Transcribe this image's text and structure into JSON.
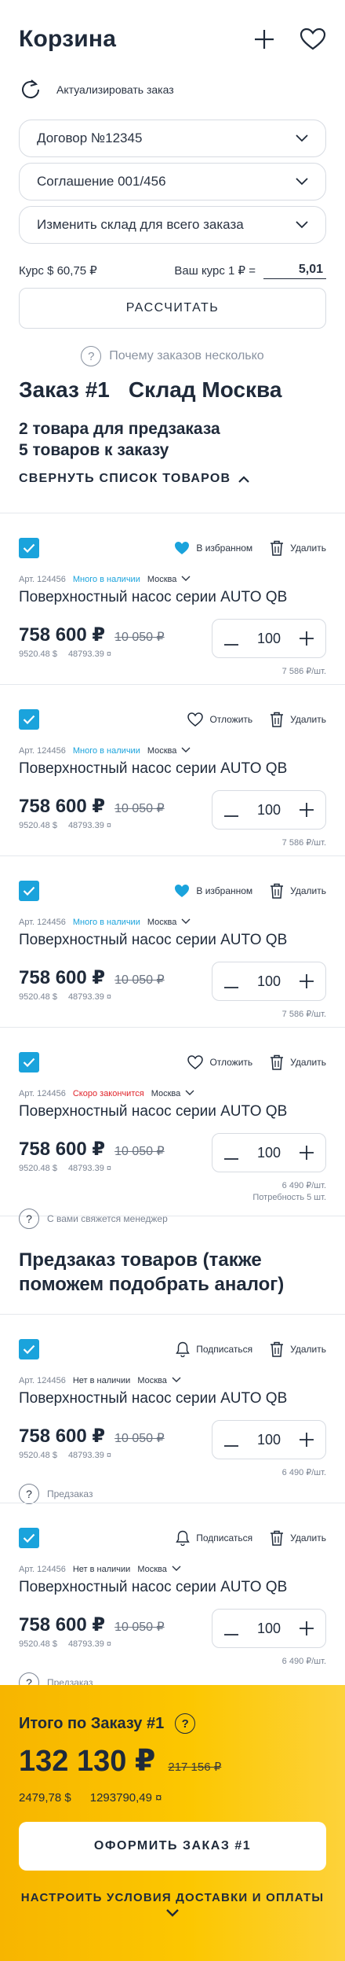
{
  "header": {
    "title": "Корзина"
  },
  "refresh": {
    "label": "Актуализировать заказ"
  },
  "selects": [
    {
      "value": "Договор №12345"
    },
    {
      "value": "Соглашение 001/456"
    },
    {
      "value": "Изменить склад для всего заказа"
    }
  ],
  "rate": {
    "current": "Курс $ 60,75 ₽",
    "custom_label": "Ваш курс 1 ₽ =",
    "custom_value": "5,01"
  },
  "calculate_button": "РАССЧИТАТЬ",
  "why_multiple": "Почему заказов несколько",
  "order": {
    "title": "Заказ #1",
    "warehouse": "Склад Москва",
    "preorder_count": "2 товара для предзаказа",
    "order_count": "5 товаров к заказу",
    "collapse_label": "СВЕРНУТЬ СПИСОК ТОВАРОВ"
  },
  "products": [
    {
      "article": "Арт. 124456",
      "status": "Много в наличии",
      "warehouse": "Москва",
      "name": "Поверхностный насос серии AUTO QB",
      "price": "758 600 ₽",
      "old_price": "10 050 ₽",
      "price_usd": "9520.48 $",
      "price_kzt": "48793.39 ¤",
      "qty": "100",
      "unit_price": "7 586 ₽/шт.",
      "fav_label": "В избранном",
      "favorited": true,
      "delete_label": "Удалить"
    },
    {
      "article": "Арт. 124456",
      "status": "Много в наличии",
      "warehouse": "Москва",
      "name": "Поверхностный насос серии AUTO QB",
      "price": "758 600 ₽",
      "old_price": "10 050 ₽",
      "price_usd": "9520.48 $",
      "price_kzt": "48793.39 ¤",
      "qty": "100",
      "unit_price": "7 586 ₽/шт.",
      "fav_label": "Отложить",
      "favorited": false,
      "delete_label": "Удалить"
    },
    {
      "article": "Арт. 124456",
      "status": "Много в наличии",
      "warehouse": "Москва",
      "name": "Поверхностный насос серии AUTO QB",
      "price": "758 600 ₽",
      "old_price": "10 050 ₽",
      "price_usd": "9520.48 $",
      "price_kzt": "48793.39 ¤",
      "qty": "100",
      "unit_price": "7 586 ₽/шт.",
      "fav_label": "В избранном",
      "favorited": true,
      "delete_label": "Удалить"
    },
    {
      "article": "Арт. 124456",
      "status": "Скоро закончится",
      "warehouse": "Москва",
      "name": "Поверхностный насос серии AUTO QB",
      "price": "758 600 ₽",
      "old_price": "10 050 ₽",
      "price_usd": "9520.48 $",
      "price_kzt": "48793.39 ¤",
      "qty": "100",
      "unit_price": "6 490 ₽/шт.",
      "need": "Потребность 5 шт.",
      "note": "С вами свяжется менеджер",
      "fav_label": "Отложить",
      "favorited": false,
      "delete_label": "Удалить"
    }
  ],
  "preorder": {
    "title": "Предзаказ товаров (также поможем подобрать аналог)",
    "items": [
      {
        "article": "Арт. 124456",
        "status": "Нет в наличии",
        "warehouse": "Москва",
        "name": "Поверхностный насос серии AUTO QB",
        "price": "758 600 ₽",
        "old_price": "10 050 ₽",
        "price_usd": "9520.48 $",
        "price_kzt": "48793.39 ¤",
        "qty": "100",
        "unit_price": "6 490 ₽/шт.",
        "note": "Предзаказ",
        "subscribe_label": "Подписаться",
        "delete_label": "Удалить"
      },
      {
        "article": "Арт. 124456",
        "status": "Нет в наличии",
        "warehouse": "Москва",
        "name": "Поверхностный насос серии AUTO QB",
        "price": "758 600 ₽",
        "old_price": "10 050 ₽",
        "price_usd": "9520.48 $",
        "price_kzt": "48793.39 ¤",
        "qty": "100",
        "unit_price": "6 490 ₽/шт.",
        "note": "Предзаказ",
        "subscribe_label": "Подписаться",
        "delete_label": "Удалить"
      }
    ]
  },
  "total": {
    "label": "Итого по Заказу #1",
    "sum": "132 130 ₽",
    "old_sum": "217 156 ₽",
    "sum_usd": "2479,78 $",
    "sum_kzt": "1293790,49 ¤",
    "checkout_label": "ОФОРМИТЬ ЗАКАЗ #1",
    "delivery_label": "НАСТРОИТЬ УСЛОВИЯ ДОСТАВКИ И ОПЛАТЫ"
  },
  "colors": {
    "accent": "#1aa3dc",
    "warning": "#e0242b",
    "total_bg": "#fcc700",
    "text": "#1f2a3a"
  },
  "icons": {
    "plus": "plus-icon",
    "heart": "heart-icon",
    "refresh": "refresh-icon",
    "chevron": "chevron-down-icon",
    "trash": "trash-icon",
    "bell": "bell-icon",
    "check": "check-icon",
    "question": "question-icon"
  }
}
